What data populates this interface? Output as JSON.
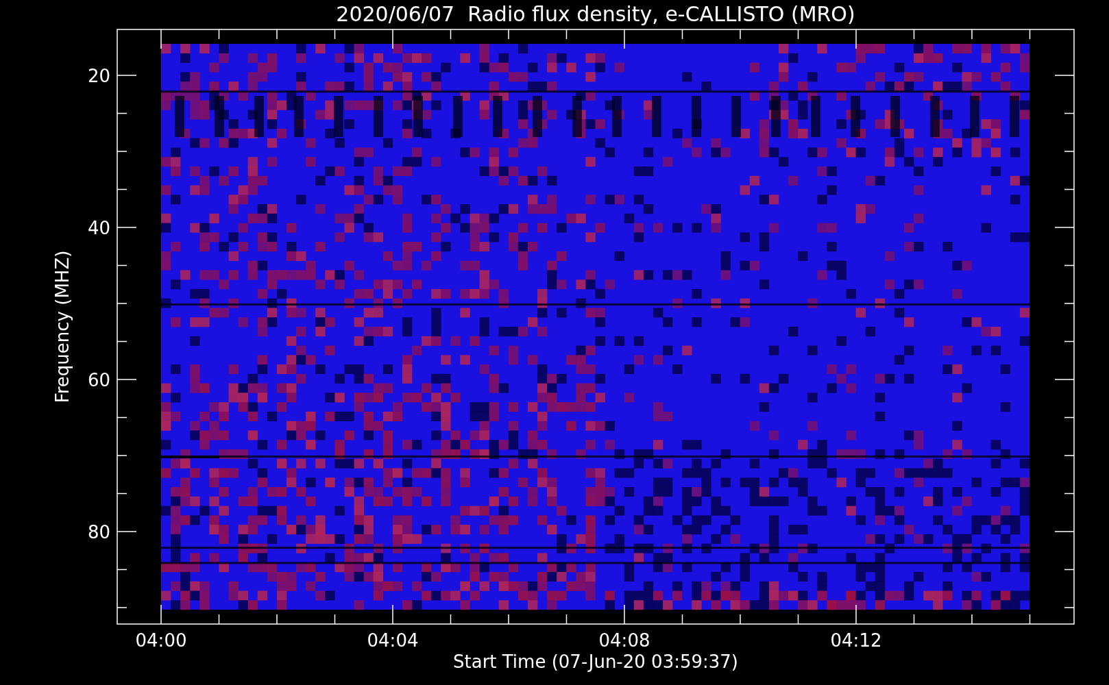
{
  "title": "2020/06/07  Radio flux density, e-CALLISTO (MRO)",
  "x_axis": {
    "label": "Start Time (07-Jun-20 03:59:37)",
    "ticks": [
      "04:00",
      "04:04",
      "04:08",
      "04:12"
    ]
  },
  "y_axis": {
    "label": "Frequency (MHZ)",
    "ticks": [
      "20",
      "40",
      "60",
      "80"
    ]
  }
}
